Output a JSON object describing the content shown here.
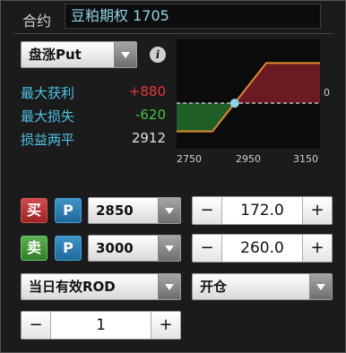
{
  "contract": {
    "label": "合约",
    "value": "豆粕期权 1705"
  },
  "option_type": {
    "selected": "盘涨Put"
  },
  "info_icon": "info-icon",
  "stats": {
    "max_profit_label": "最大获利",
    "max_profit_value": "+880",
    "max_loss_label": "最大损失",
    "max_loss_value": "-620",
    "breakeven_label": "损益两平",
    "breakeven_value": "2912"
  },
  "colors": {
    "profit": "#e53935",
    "loss": "#43c243",
    "accent": "#4fc3e6"
  },
  "chart_data": {
    "type": "line",
    "x": [
      2750,
      2850,
      2912,
      3000,
      3150
    ],
    "y": [
      -620,
      -620,
      0,
      880,
      880
    ],
    "x_ticks": [
      "2750",
      "2950",
      "3150"
    ],
    "y_zero_label": "0",
    "xlim": [
      2750,
      3150
    ],
    "ylim": [
      -1000,
      1400
    ],
    "grid": false
  },
  "leg1": {
    "side": "买",
    "type": "P",
    "strike": "2850",
    "price": "172.0"
  },
  "leg2": {
    "side": "卖",
    "type": "P",
    "strike": "3000",
    "price": "260.0"
  },
  "validity": {
    "selected": "当日有效ROD"
  },
  "open_close": {
    "selected": "开仓"
  },
  "quantity": {
    "value": "1"
  },
  "stepper": {
    "minus": "−",
    "plus": "+"
  }
}
